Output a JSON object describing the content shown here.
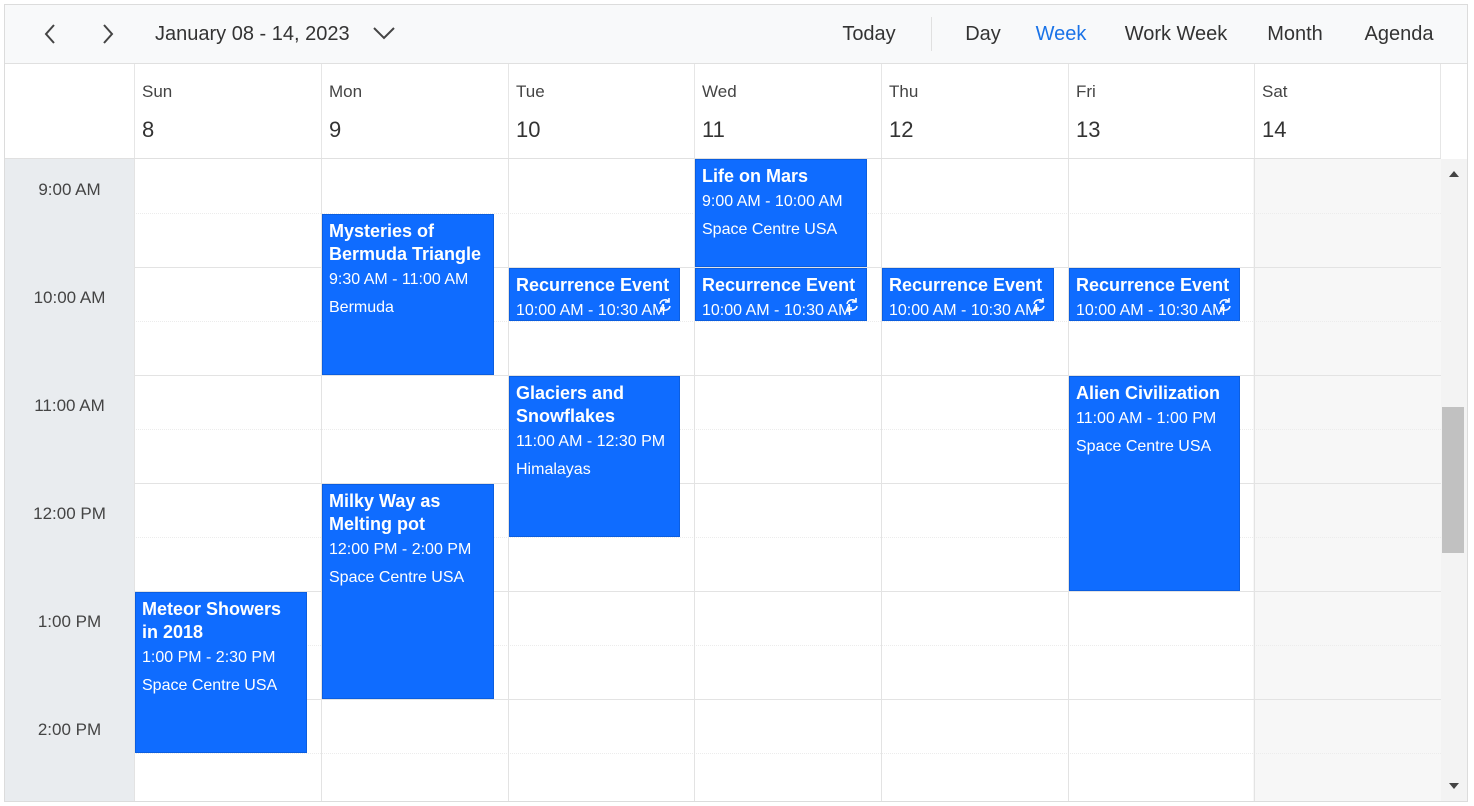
{
  "toolbar": {
    "prev_icon": "chevron-left-icon",
    "next_icon": "chevron-right-icon",
    "date_range": "January 08 - 14, 2023",
    "dropdown_icon": "chevron-down-icon",
    "today": "Today",
    "views": [
      "Day",
      "Week",
      "Work Week",
      "Month",
      "Agenda"
    ],
    "active_view": "Week",
    "accent_color": "#1a73e8"
  },
  "days": [
    {
      "name": "Sun",
      "num": "8"
    },
    {
      "name": "Mon",
      "num": "9"
    },
    {
      "name": "Tue",
      "num": "10"
    },
    {
      "name": "Wed",
      "num": "11"
    },
    {
      "name": "Thu",
      "num": "12"
    },
    {
      "name": "Fri",
      "num": "13"
    },
    {
      "name": "Sat",
      "num": "14"
    }
  ],
  "times": [
    "9:00 AM",
    "10:00 AM",
    "11:00 AM",
    "12:00 PM",
    "1:00 PM",
    "2:00 PM"
  ],
  "event_color": "#0f6cff",
  "events": [
    {
      "title": "Life on Mars",
      "time": "9:00 AM - 10:00 AM",
      "location": "Space Centre USA",
      "day": "Wed"
    },
    {
      "title": "Mysteries of Bermuda Triangle",
      "time": "9:30 AM - 11:00 AM",
      "location": "Bermuda",
      "day": "Mon"
    },
    {
      "title": "Recurrence Event",
      "time": "10:00 AM - 10:30 AM",
      "day": "Tue",
      "recurring": true
    },
    {
      "title": "Recurrence Event",
      "time": "10:00 AM - 10:30 AM",
      "day": "Wed",
      "recurring": true
    },
    {
      "title": "Recurrence Event",
      "time": "10:00 AM - 10:30 AM",
      "day": "Thu",
      "recurring": true
    },
    {
      "title": "Recurrence Event",
      "time": "10:00 AM - 10:30 AM",
      "day": "Fri",
      "recurring": true
    },
    {
      "title": "Glaciers and Snowflakes",
      "time": "11:00 AM - 12:30 PM",
      "location": "Himalayas",
      "day": "Tue"
    },
    {
      "title": "Alien Civilization",
      "time": "11:00 AM - 1:00 PM",
      "location": "Space Centre USA",
      "day": "Fri"
    },
    {
      "title": "Milky Way as Melting pot",
      "time": "12:00 PM - 2:00 PM",
      "location": "Space Centre USA",
      "day": "Mon"
    },
    {
      "title": "Meteor Showers in 2018",
      "time": "1:00 PM - 2:30 PM",
      "location": "Space Centre USA",
      "day": "Sun"
    }
  ]
}
